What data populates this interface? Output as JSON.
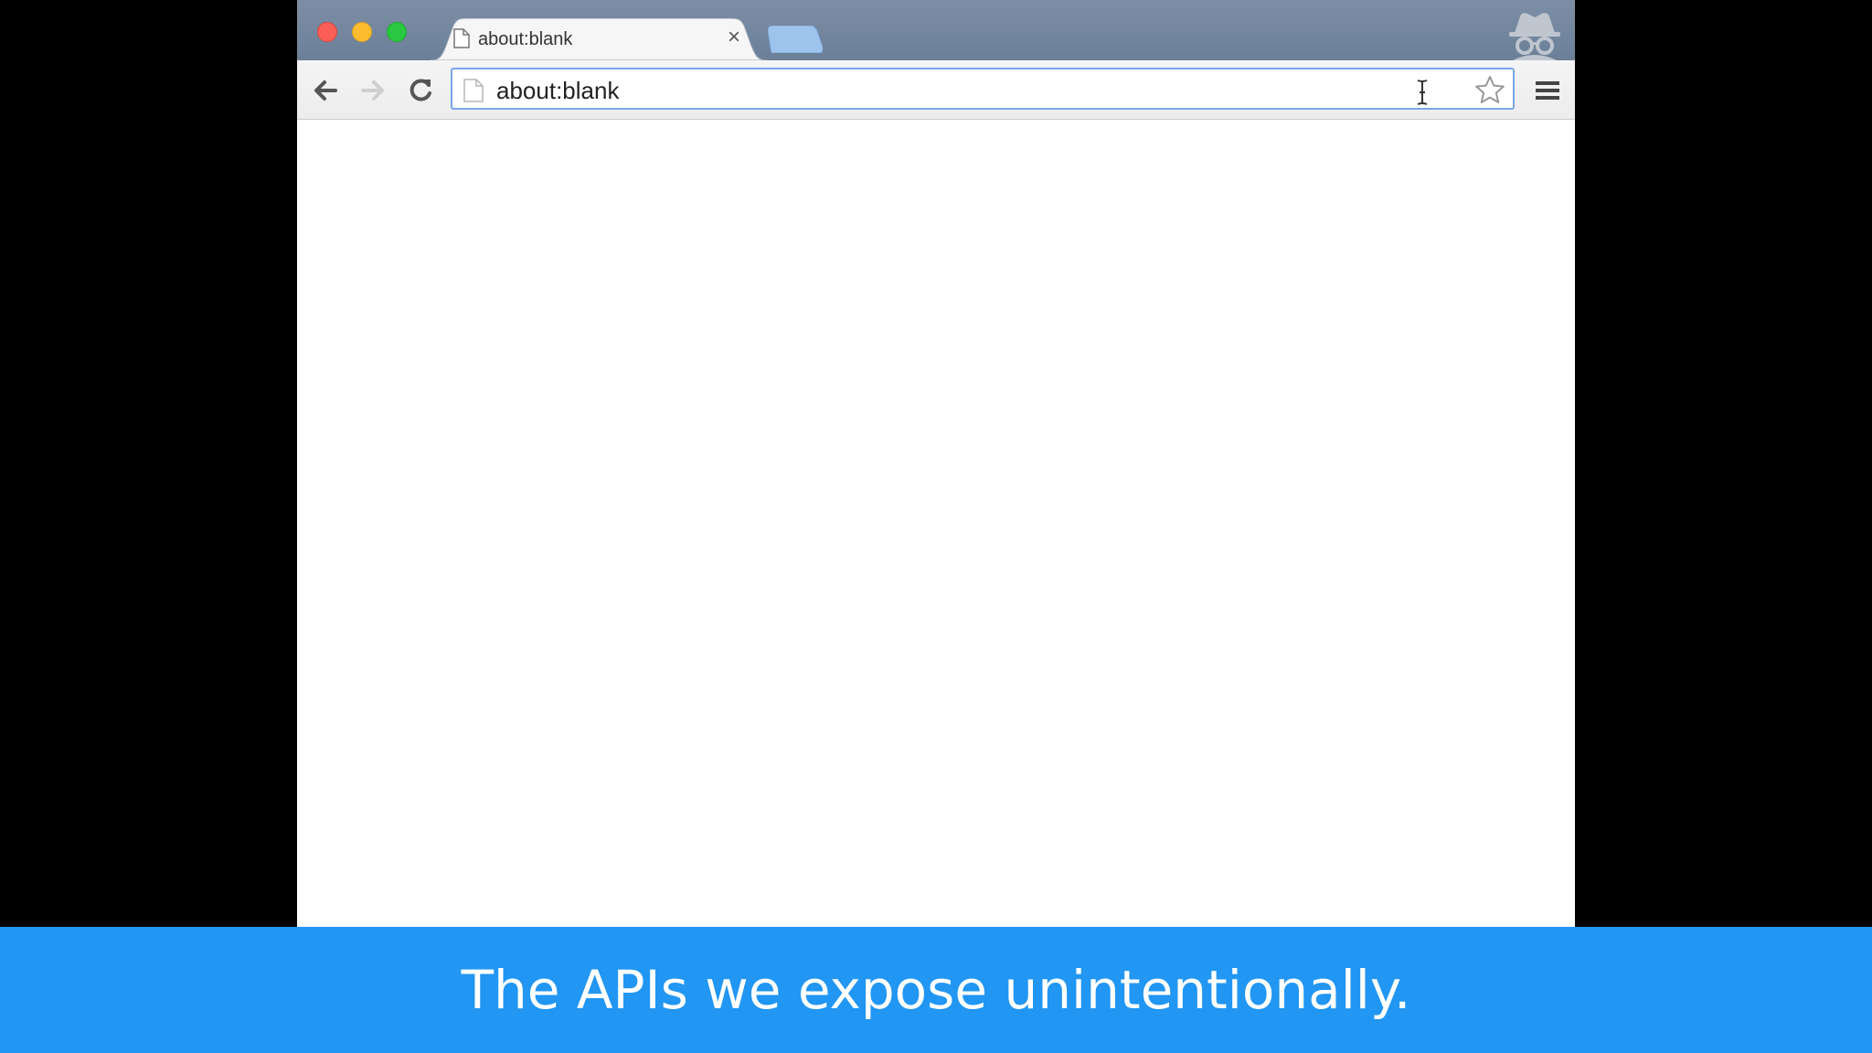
{
  "browser": {
    "tab": {
      "title": "about:blank",
      "close_label": "×"
    },
    "omnibox": {
      "url": "about:blank"
    }
  },
  "caption": {
    "text": "The APIs we expose unintentionally."
  },
  "colors": {
    "caption_background": "#2196f3",
    "titlebar": "#7387a0",
    "omnibox_focus_border": "#7aa6e8"
  },
  "icons": {
    "back": "back-arrow-icon",
    "forward": "forward-arrow-icon",
    "reload": "reload-icon",
    "bookmark": "star-icon",
    "menu": "hamburger-menu-icon",
    "incognito": "incognito-icon",
    "page": "blank-page-icon"
  }
}
